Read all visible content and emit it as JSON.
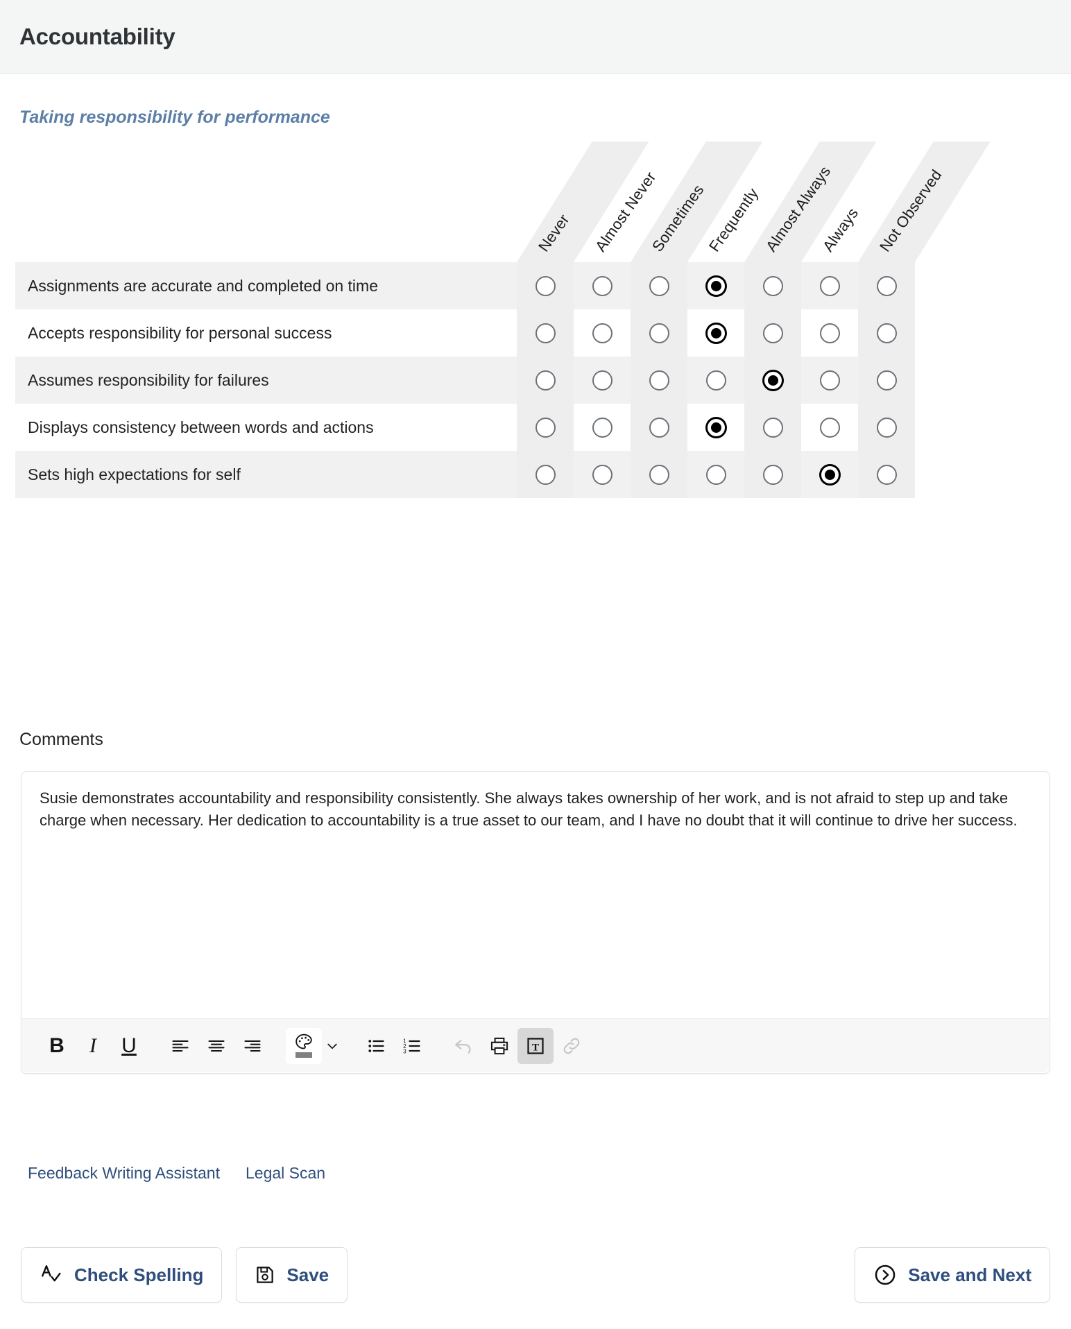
{
  "header": {
    "title": "Accountability"
  },
  "subtitle": "Taking responsibility for performance",
  "matrix": {
    "columns": [
      "Never",
      "Almost Never",
      "Sometimes",
      "Frequently",
      "Almost Always",
      "Always",
      "Not Observed"
    ],
    "rows": [
      {
        "label": "Assignments are accurate and completed on time",
        "selected": 3
      },
      {
        "label": "Accepts responsibility for personal success",
        "selected": 3
      },
      {
        "label": "Assumes responsibility for failures",
        "selected": 4
      },
      {
        "label": "Displays consistency between words and actions",
        "selected": 3
      },
      {
        "label": "Sets high expectations for self",
        "selected": 5
      }
    ]
  },
  "comments": {
    "label": "Comments",
    "value": "Susie demonstrates accountability and responsibility consistently. She always takes ownership of her work, and is not afraid to step up and take charge when necessary. Her dedication to accountability is a true asset to our team, and I have no doubt that it will continue to drive her success.",
    "placeholder": ""
  },
  "toolbar": {
    "bold": "B",
    "italic": "I",
    "underline": "U",
    "items": [
      {
        "name": "bold-button",
        "icon": "bold-icon"
      },
      {
        "name": "italic-button",
        "icon": "italic-icon"
      },
      {
        "name": "underline-button",
        "icon": "underline-icon"
      },
      {
        "name": "align-left-button",
        "icon": "align-left-icon"
      },
      {
        "name": "align-center-button",
        "icon": "align-center-icon"
      },
      {
        "name": "align-right-button",
        "icon": "align-right-icon"
      },
      {
        "name": "text-color-button",
        "icon": "color-palette-icon"
      },
      {
        "name": "text-color-dropdown",
        "icon": "chevron-down-icon"
      },
      {
        "name": "bullet-list-button",
        "icon": "bullet-list-icon"
      },
      {
        "name": "numbered-list-button",
        "icon": "numbered-list-icon"
      },
      {
        "name": "undo-button",
        "icon": "undo-arrow-icon"
      },
      {
        "name": "print-button",
        "icon": "printer-icon"
      },
      {
        "name": "clear-formatting-button",
        "icon": "text-format-icon"
      },
      {
        "name": "insert-link-button",
        "icon": "link-icon"
      }
    ],
    "color_swatch": "#808080"
  },
  "assistant_links": [
    {
      "label": "Feedback Writing Assistant"
    },
    {
      "label": "Legal Scan"
    }
  ],
  "footer": {
    "check_spelling": "Check Spelling",
    "save": "Save",
    "save_and_next": "Save and Next"
  },
  "colors": {
    "header_bg": "#f4f5f5",
    "subtitle": "#5b7fa6",
    "link": "#2f4e7d",
    "row_stripe": "#f1f1f1",
    "column_stripe": "#eeeeee"
  }
}
